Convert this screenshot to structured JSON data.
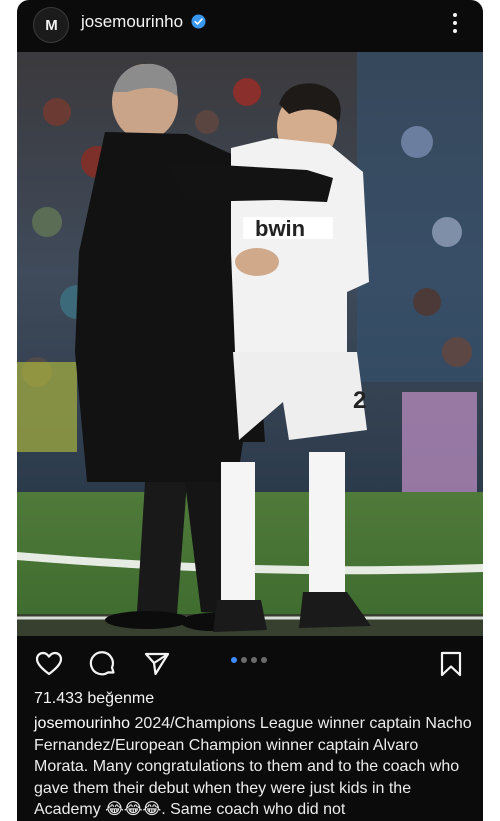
{
  "post": {
    "author_avatar_text": "M",
    "username": "josemourinho",
    "verified": true,
    "more_icon": "more-vertical-icon",
    "photo_alt": "Mourinho with Real Madrid player at sideline",
    "carousel": {
      "total": 4,
      "active": 1
    },
    "likes": "71.433 beğenme",
    "caption_user": "josemourinho",
    "caption_text": "2024/Champions League winner captain Nacho Fernandez/European Champion winner captain Alvaro Morata. Many congratulations to them and to the coach who gave them their debut when they were just kids in the Academy 😂😂😂. Same coach who did not",
    "jersey_text": "bwin",
    "jersey_number": "2"
  },
  "icons": {
    "like": "heart-icon",
    "comment": "comment-icon",
    "share": "send-icon",
    "save": "bookmark-icon"
  },
  "colors": {
    "background": "#0b0b0b",
    "verified_badge": "#3897f0",
    "active_dot": "#3d8cff"
  }
}
